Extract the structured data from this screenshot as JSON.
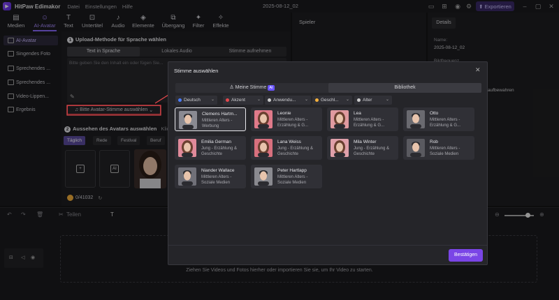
{
  "app": {
    "name": "HitPaw Edimakor",
    "menu": [
      "Datei",
      "Einstellungen",
      "Hilfe"
    ],
    "project_name": "2025-08-12_02",
    "export_label": "Exportieren"
  },
  "toolbar": {
    "items": [
      {
        "label": "Medien",
        "icon": "folder-icon"
      },
      {
        "label": "AI-Avatar",
        "icon": "ai-avatar-icon",
        "active": true
      },
      {
        "label": "Text",
        "icon": "text-icon"
      },
      {
        "label": "Untertitel",
        "icon": "subtitle-icon"
      },
      {
        "label": "Audio",
        "icon": "audio-icon"
      },
      {
        "label": "Elemente",
        "icon": "elements-icon"
      },
      {
        "label": "Übergang",
        "icon": "transition-icon"
      },
      {
        "label": "Filter",
        "icon": "filter-icon"
      },
      {
        "label": "Effekte",
        "icon": "effects-icon"
      }
    ]
  },
  "leftrail": {
    "items": [
      {
        "label": "AI-Avatar",
        "active": true
      },
      {
        "label": "Singendes Foto"
      },
      {
        "label": "Sprechendes ..."
      },
      {
        "label": "Sprechendes ..."
      },
      {
        "label": "Video-Lippen..."
      },
      {
        "label": "Ergebnis"
      }
    ]
  },
  "avatar_panel": {
    "section1_num": "1",
    "section1_title": "Upload-Methode für Sprache wählen",
    "tabs": [
      "Text in Sprache",
      "Lokales Audio",
      "Stimme aufnehmen"
    ],
    "text_placeholder": "Bitte geben Sie den Inhalt ein oder fügen Sie...",
    "voice_button": "Bitte Avatar-Stimme auswählen",
    "section2_num": "2",
    "section2_title": "Aussehen des Avatars auswählen",
    "section2_hint": "Klick",
    "chips": [
      "Täglich",
      "Rede",
      "Festival",
      "Beruf"
    ],
    "credits": "0/41032"
  },
  "player": {
    "title": "Spieler"
  },
  "details": {
    "tab": "Details",
    "name_label": "Name:",
    "name_value": "2025-08-12_02",
    "partial_label": "Bildfrequenz",
    "partial_value": "aufbewahren"
  },
  "timeline": {
    "split_label": "Teilen",
    "drop_text": "Ziehen Sie Videos und Fotos hierher oder importieren Sie sie, um Ihr Video zu starten."
  },
  "modal": {
    "title": "Stimme auswählen",
    "tabs": [
      "Meine Stimme",
      "Bibliothek"
    ],
    "ai_badge": "AI",
    "filters": [
      {
        "label": "Deutsch",
        "color": "#4a7dff"
      },
      {
        "label": "Akzent",
        "color": "#e5484d"
      },
      {
        "label": "Anwendu...",
        "color": "#cccccc"
      },
      {
        "label": "Geschl...",
        "color": "#f5b13d"
      },
      {
        "label": "Alter",
        "color": "#cccccc"
      }
    ],
    "voices": [
      {
        "name": "Clemens Hartm...",
        "desc": "Mittleren Alters - Werbung",
        "selected": true,
        "gender": "m",
        "bg": "#8a8a92"
      },
      {
        "name": "Leonie",
        "desc": "Mittleren Alters - Erzählung & G...",
        "gender": "f",
        "bg": "#e07a8a"
      },
      {
        "name": "Lea",
        "desc": "Mittleren Alters - Erzählung & G...",
        "gender": "f",
        "bg": "#e09aa0"
      },
      {
        "name": "Otto",
        "desc": "Mittleren Alters - Erzählung & G...",
        "gender": "m",
        "bg": "#6a6a70"
      },
      {
        "name": "Emilia German",
        "desc": "Jung - Erzählung & Geschichte",
        "gender": "f",
        "bg": "#e08a9a"
      },
      {
        "name": "Lana Weiss",
        "desc": "Jung - Erzählung & Geschichte",
        "gender": "f",
        "bg": "#d8707e"
      },
      {
        "name": "Mila Winter",
        "desc": "Jung - Erzählung & Geschichte",
        "gender": "f",
        "bg": "#e0a0aa"
      },
      {
        "name": "Rob",
        "desc": "Mittleren Alters - Soziale Medien",
        "gender": "m",
        "bg": "#5a5a60"
      },
      {
        "name": "Niander Wallace",
        "desc": "Mittleren Alters - Soziale Medien",
        "gender": "m",
        "bg": "#707078"
      },
      {
        "name": "Peter Hartlapp",
        "desc": "Mittleren Alters - Soziale Medien",
        "gender": "m",
        "bg": "#8a8a90"
      }
    ],
    "confirm": "Bestätigen"
  },
  "colors": {
    "accent": "#7a45e6",
    "highlight_border": "#e5484d"
  }
}
